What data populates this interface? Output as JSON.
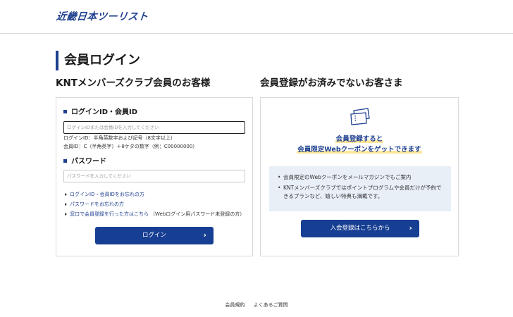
{
  "header": {
    "logo_text": "近畿日本ツーリスト"
  },
  "page": {
    "title": "会員ログイン"
  },
  "left": {
    "heading": "KNTメンバーズクラブ会員のお客様",
    "id_label": "ログインID・会員ID",
    "id_placeholder": "ログインIDまたは会員IDを入力してください",
    "id_hint": "ログインID：半角英数字および記号（8文字以上）",
    "member_hint": "会員ID：C（半角英字）＋8ケタの数字（例：C00000000）",
    "password_label": "パスワード",
    "password_placeholder": "パスワードを入力してください",
    "links": [
      {
        "text": "ログインID・会員IDをお忘れの方",
        "note": ""
      },
      {
        "text": "パスワードをお忘れの方",
        "note": ""
      },
      {
        "text": "窓口で会員登録を行った方はこちら",
        "note": "（Webログイン用パスワード未登録の方）"
      }
    ],
    "login_button": "ログイン"
  },
  "right": {
    "heading": "会員登録がお済みでないお客さま",
    "promo_line1": "会員登録すると",
    "promo_line2": "会員限定Webクーポンをゲットできます",
    "benefits": [
      "会員限定のWebクーポンをメールマガジンでもご案内",
      "KNTメンバーズクラブではポイントプログラムや会員だけが予約できるプランなど、嬉しい特典も満載です。"
    ],
    "join_button": "入会登録はこちらから"
  },
  "footer": {
    "links": [
      "会員規約",
      "よくあるご質問"
    ]
  },
  "colors": {
    "brand": "#1d3f8f",
    "button": "#163e93",
    "info_bg": "#e8eff7",
    "highlight": "#fbe79a"
  },
  "icons": {
    "ticket": "ticket-icon",
    "chevron": "chevron-right-icon"
  }
}
